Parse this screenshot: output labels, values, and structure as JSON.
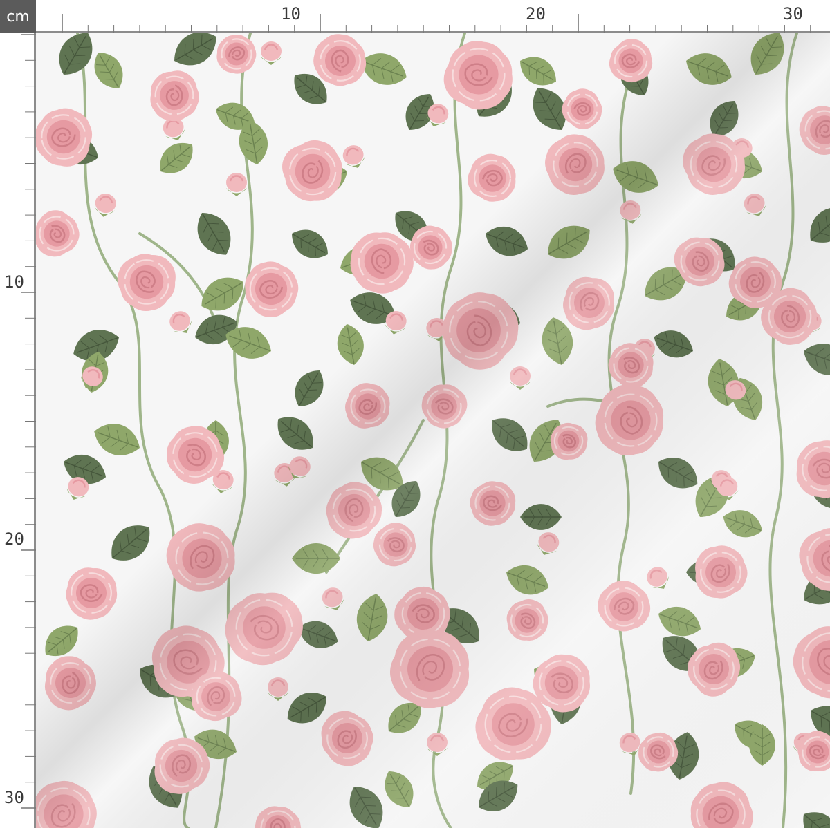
{
  "ruler": {
    "unit": "cm",
    "top_labels": [
      "10",
      "20",
      "30"
    ],
    "left_labels": [
      "10",
      "20",
      "30"
    ]
  },
  "colors": {
    "background": "#f6f6f6",
    "rose_light": "#f1b9bd",
    "rose_mid": "#e69aa2",
    "rose_dark": "#cf7f88",
    "leaf_light": "#8fa76a",
    "leaf_dark": "#5f7452",
    "stem": "#9fb58a"
  }
}
